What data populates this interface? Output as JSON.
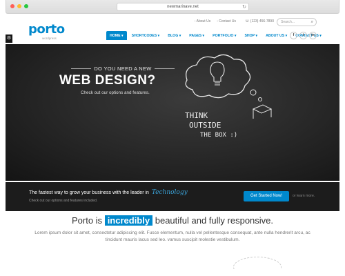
{
  "browser": {
    "url": "newmarinave.net",
    "traffic_colors": [
      "#ff5f57",
      "#febc2e",
      "#28c840"
    ]
  },
  "header": {
    "logo": "porto",
    "logo_sub": "wordpress",
    "top_links": [
      "About Us",
      "Contact Us"
    ],
    "phone": "(123) 456-7890",
    "search_placeholder": "Search...",
    "nav": [
      {
        "label": "HOME ▾",
        "active": true
      },
      {
        "label": "SHORTCODES ▾"
      },
      {
        "label": "BLOG ▾"
      },
      {
        "label": "PAGES ▾"
      },
      {
        "label": "PORTFOLIO ▾"
      },
      {
        "label": "SHOP ▾"
      },
      {
        "label": "ABOUT US ▾"
      },
      {
        "label": "CONTACT US ▾"
      }
    ],
    "social": [
      "f",
      "t",
      "in"
    ]
  },
  "hero": {
    "eyebrow": "DO YOU NEED A NEW",
    "title": "WEB DESIGN?",
    "subtitle": "Check out our options and features.",
    "chalk_lines": [
      "THINK",
      "OUTSIDE",
      "THE BOX :)"
    ]
  },
  "banner": {
    "lead": "The fastest way to grow your business with the leader in",
    "accent_word": "Technology",
    "sub": "Check out our options and features included.",
    "cta_label": "Get Started Now!",
    "learn_more": "or learn more."
  },
  "content": {
    "headline_pre": "Porto is",
    "headline_highlight": "incredibly",
    "headline_post": "beautiful and fully responsive.",
    "paragraph": "Lorem ipsum dolor sit amet, consectetur adipiscing elit. Fusce elementum, nulla vel pellentesque consequat, ante nulla hendrerit arcu, ac tincidunt mauris lacus sed leo. vamus suscipit molestie vestibulum."
  },
  "colors": {
    "brand": "#0088cc",
    "hero_bg": "#262626",
    "strip_bg": "#1c1c1c"
  }
}
